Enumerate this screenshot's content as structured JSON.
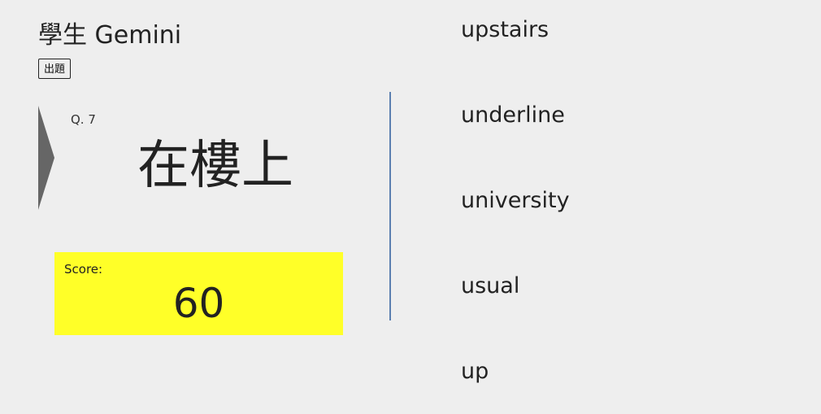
{
  "header": {
    "title": "學生 Gemini",
    "generate_button_label": "出題"
  },
  "question": {
    "number_label": "Q. 7",
    "prompt": "在樓上"
  },
  "score": {
    "label": "Score:",
    "value": "60"
  },
  "choices": [
    "upstairs",
    "underline",
    "university",
    "usual",
    "up"
  ],
  "colors": {
    "background": "#eeeeee",
    "score_box": "#ffff28",
    "divider": "#5b7fb0",
    "arrow": "#666666"
  },
  "icons": {
    "next": "triangle-right-icon"
  }
}
